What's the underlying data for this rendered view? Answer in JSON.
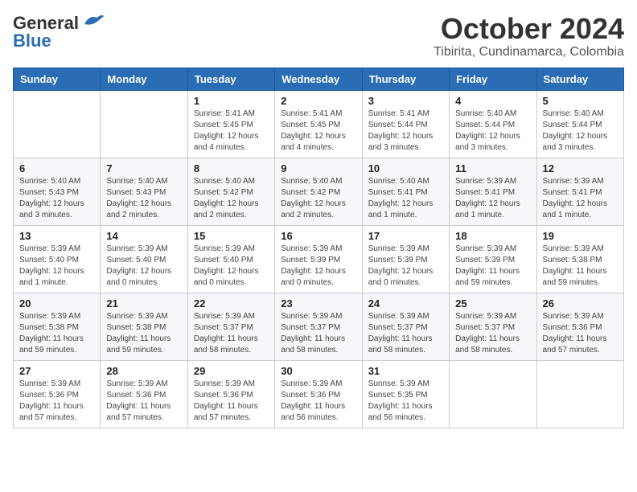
{
  "header": {
    "logo_general": "General",
    "logo_blue": "Blue",
    "month": "October 2024",
    "location": "Tibirita, Cundinamarca, Colombia"
  },
  "weekdays": [
    "Sunday",
    "Monday",
    "Tuesday",
    "Wednesday",
    "Thursday",
    "Friday",
    "Saturday"
  ],
  "weeks": [
    [
      {
        "day": "",
        "info": ""
      },
      {
        "day": "",
        "info": ""
      },
      {
        "day": "1",
        "info": "Sunrise: 5:41 AM\nSunset: 5:45 PM\nDaylight: 12 hours\nand 4 minutes."
      },
      {
        "day": "2",
        "info": "Sunrise: 5:41 AM\nSunset: 5:45 PM\nDaylight: 12 hours\nand 4 minutes."
      },
      {
        "day": "3",
        "info": "Sunrise: 5:41 AM\nSunset: 5:44 PM\nDaylight: 12 hours\nand 3 minutes."
      },
      {
        "day": "4",
        "info": "Sunrise: 5:40 AM\nSunset: 5:44 PM\nDaylight: 12 hours\nand 3 minutes."
      },
      {
        "day": "5",
        "info": "Sunrise: 5:40 AM\nSunset: 5:44 PM\nDaylight: 12 hours\nand 3 minutes."
      }
    ],
    [
      {
        "day": "6",
        "info": "Sunrise: 5:40 AM\nSunset: 5:43 PM\nDaylight: 12 hours\nand 3 minutes."
      },
      {
        "day": "7",
        "info": "Sunrise: 5:40 AM\nSunset: 5:43 PM\nDaylight: 12 hours\nand 2 minutes."
      },
      {
        "day": "8",
        "info": "Sunrise: 5:40 AM\nSunset: 5:42 PM\nDaylight: 12 hours\nand 2 minutes."
      },
      {
        "day": "9",
        "info": "Sunrise: 5:40 AM\nSunset: 5:42 PM\nDaylight: 12 hours\nand 2 minutes."
      },
      {
        "day": "10",
        "info": "Sunrise: 5:40 AM\nSunset: 5:41 PM\nDaylight: 12 hours\nand 1 minute."
      },
      {
        "day": "11",
        "info": "Sunrise: 5:39 AM\nSunset: 5:41 PM\nDaylight: 12 hours\nand 1 minute."
      },
      {
        "day": "12",
        "info": "Sunrise: 5:39 AM\nSunset: 5:41 PM\nDaylight: 12 hours\nand 1 minute."
      }
    ],
    [
      {
        "day": "13",
        "info": "Sunrise: 5:39 AM\nSunset: 5:40 PM\nDaylight: 12 hours\nand 1 minute."
      },
      {
        "day": "14",
        "info": "Sunrise: 5:39 AM\nSunset: 5:40 PM\nDaylight: 12 hours\nand 0 minutes."
      },
      {
        "day": "15",
        "info": "Sunrise: 5:39 AM\nSunset: 5:40 PM\nDaylight: 12 hours\nand 0 minutes."
      },
      {
        "day": "16",
        "info": "Sunrise: 5:39 AM\nSunset: 5:39 PM\nDaylight: 12 hours\nand 0 minutes."
      },
      {
        "day": "17",
        "info": "Sunrise: 5:39 AM\nSunset: 5:39 PM\nDaylight: 12 hours\nand 0 minutes."
      },
      {
        "day": "18",
        "info": "Sunrise: 5:39 AM\nSunset: 5:39 PM\nDaylight: 11 hours\nand 59 minutes."
      },
      {
        "day": "19",
        "info": "Sunrise: 5:39 AM\nSunset: 5:38 PM\nDaylight: 11 hours\nand 59 minutes."
      }
    ],
    [
      {
        "day": "20",
        "info": "Sunrise: 5:39 AM\nSunset: 5:38 PM\nDaylight: 11 hours\nand 59 minutes."
      },
      {
        "day": "21",
        "info": "Sunrise: 5:39 AM\nSunset: 5:38 PM\nDaylight: 11 hours\nand 59 minutes."
      },
      {
        "day": "22",
        "info": "Sunrise: 5:39 AM\nSunset: 5:37 PM\nDaylight: 11 hours\nand 58 minutes."
      },
      {
        "day": "23",
        "info": "Sunrise: 5:39 AM\nSunset: 5:37 PM\nDaylight: 11 hours\nand 58 minutes."
      },
      {
        "day": "24",
        "info": "Sunrise: 5:39 AM\nSunset: 5:37 PM\nDaylight: 11 hours\nand 58 minutes."
      },
      {
        "day": "25",
        "info": "Sunrise: 5:39 AM\nSunset: 5:37 PM\nDaylight: 11 hours\nand 58 minutes."
      },
      {
        "day": "26",
        "info": "Sunrise: 5:39 AM\nSunset: 5:36 PM\nDaylight: 11 hours\nand 57 minutes."
      }
    ],
    [
      {
        "day": "27",
        "info": "Sunrise: 5:39 AM\nSunset: 5:36 PM\nDaylight: 11 hours\nand 57 minutes."
      },
      {
        "day": "28",
        "info": "Sunrise: 5:39 AM\nSunset: 5:36 PM\nDaylight: 11 hours\nand 57 minutes."
      },
      {
        "day": "29",
        "info": "Sunrise: 5:39 AM\nSunset: 5:36 PM\nDaylight: 11 hours\nand 57 minutes."
      },
      {
        "day": "30",
        "info": "Sunrise: 5:39 AM\nSunset: 5:36 PM\nDaylight: 11 hours\nand 56 minutes."
      },
      {
        "day": "31",
        "info": "Sunrise: 5:39 AM\nSunset: 5:35 PM\nDaylight: 11 hours\nand 56 minutes."
      },
      {
        "day": "",
        "info": ""
      },
      {
        "day": "",
        "info": ""
      }
    ]
  ]
}
